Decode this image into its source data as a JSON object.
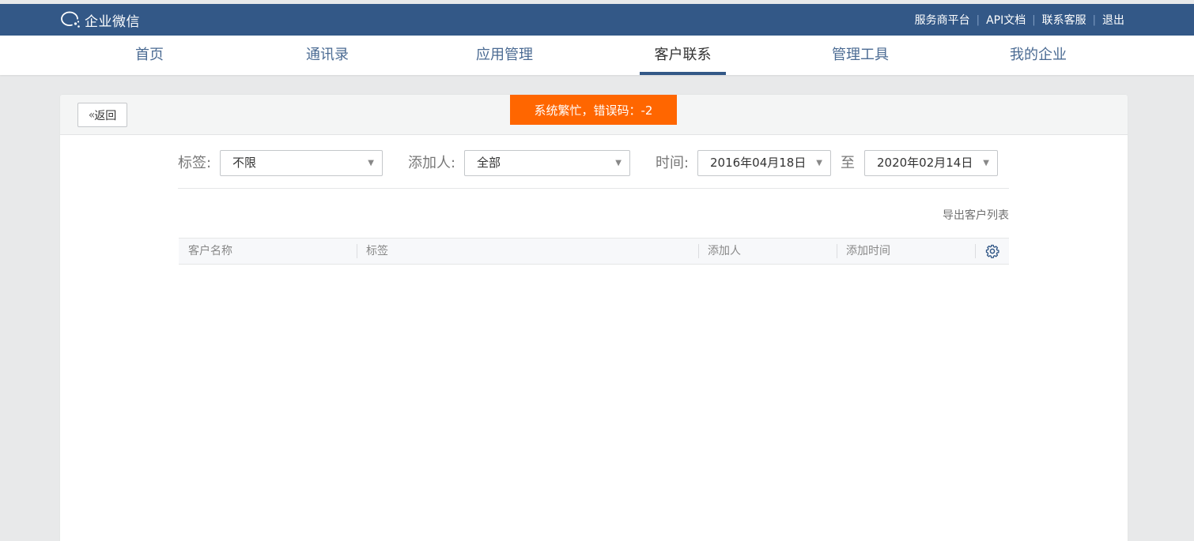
{
  "app": {
    "logo_text": "企业微信"
  },
  "top_links": {
    "service_platform": "服务商平台",
    "api_docs": "API文档",
    "contact_support": "联系客服",
    "logout": "退出",
    "separator": "|"
  },
  "nav": {
    "items": [
      {
        "label": "首页"
      },
      {
        "label": "通讯录"
      },
      {
        "label": "应用管理"
      },
      {
        "label": "客户联系",
        "active": true
      },
      {
        "label": "管理工具"
      },
      {
        "label": "我的企业"
      }
    ]
  },
  "toolbar": {
    "back_label": "返回",
    "back_glyph": "«"
  },
  "toast": {
    "message": "系统繁忙，错误码：-2",
    "color": "#ff6600"
  },
  "filters": {
    "tag_label": "标签:",
    "tag_value": "不限",
    "adder_label": "添加人:",
    "adder_value": "全部",
    "time_label": "时间:",
    "start_date": "2016年04月18日",
    "to_label": "至",
    "end_date": "2020年02月14日"
  },
  "actions": {
    "export_label": "导出客户列表"
  },
  "table": {
    "columns": [
      "客户名称",
      "标签",
      "添加人",
      "添加时间"
    ],
    "rows": []
  },
  "colors": {
    "brand": "#335887",
    "toast": "#ff6600",
    "background": "#e8e9ea"
  },
  "icons": {
    "logo": "wecom-bubble-icon",
    "settings": "gear-icon",
    "dropdown": "caret-down-icon"
  }
}
